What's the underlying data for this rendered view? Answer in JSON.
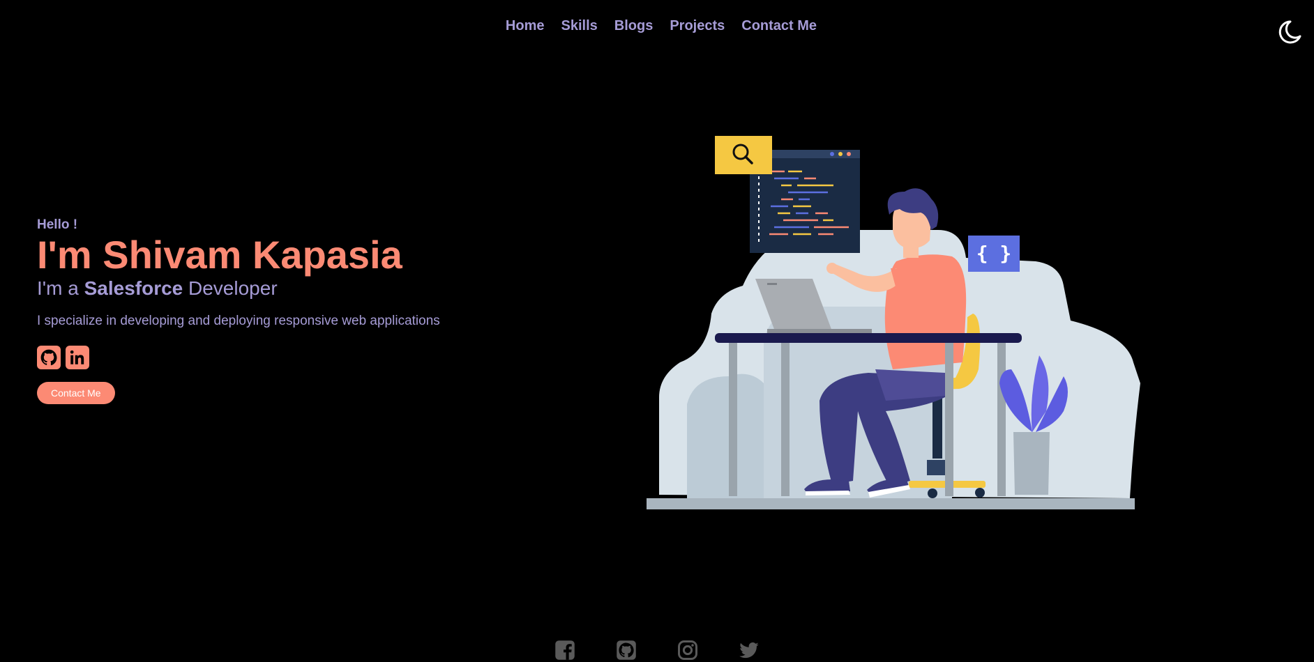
{
  "nav": {
    "items": [
      {
        "label": "Home"
      },
      {
        "label": "Skills"
      },
      {
        "label": "Blogs"
      },
      {
        "label": "Projects"
      },
      {
        "label": "Contact Me"
      }
    ],
    "theme_toggle_icon": "moon-icon"
  },
  "hero": {
    "greeting": "Hello !",
    "name": "I'm Shivam Kapasia",
    "role_prefix": "I'm a ",
    "role_highlight": "Salesforce",
    "role_suffix": " Developer",
    "tagline": "I specialize in developing and deploying responsive web applications",
    "social_icons": [
      "github-icon",
      "linkedin-icon"
    ],
    "contact_button": "Contact Me"
  },
  "footer": {
    "icons": [
      "facebook-icon",
      "github-icon",
      "instagram-icon",
      "twitter-icon"
    ]
  },
  "colors": {
    "background": "#000000",
    "accent": "#fc8a74",
    "text": "#a69cd6"
  }
}
